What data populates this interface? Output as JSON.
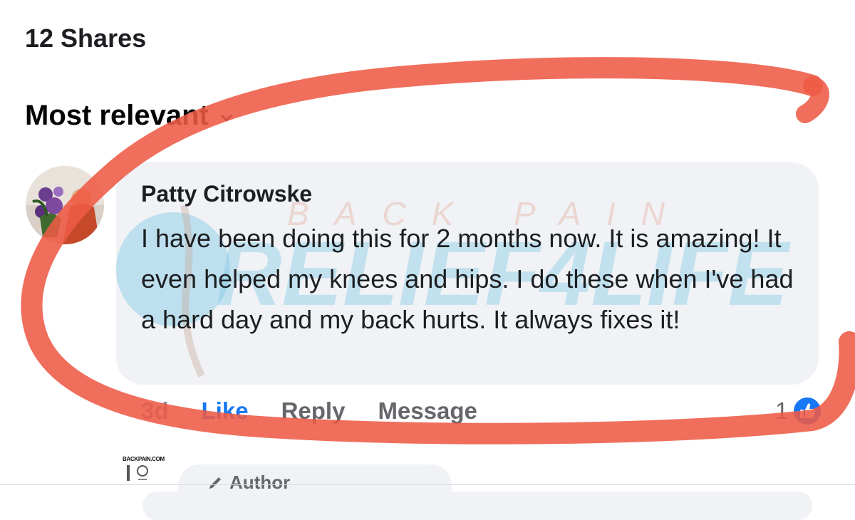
{
  "shares": {
    "label": "12 Shares"
  },
  "sort": {
    "label": "Most relevant",
    "icon": "chevron-down-icon"
  },
  "comment": {
    "author": "Patty Citrowske",
    "text": "I have been doing this for 2 months now. It is amazing! It even helped my knees and hips. I do these when I've had a hard day and my back hurts. It always fixes it!",
    "watermark_top": "BACK PAIN",
    "watermark_main": "RELIEF4LIFE",
    "time": "3d",
    "like_label": "Like",
    "reply_label": "Reply",
    "message_label": "Message",
    "reaction_count": "1",
    "reaction_icon": "thumbs-up-icon"
  },
  "reply": {
    "avatar_brand": "BACKPAIN.COM",
    "badge_label": "Author"
  },
  "colors": {
    "accent": "#1877f2",
    "bubble": "#f0f2f5",
    "highlight_stroke": "#ee5a45",
    "muted_text": "#65676b"
  }
}
